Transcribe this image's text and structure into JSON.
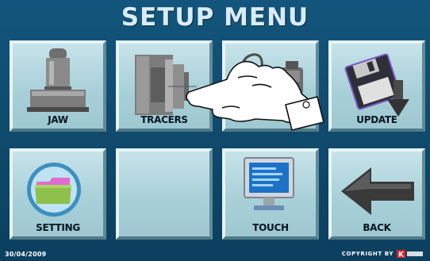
{
  "header": {
    "title": "SETUP MENU"
  },
  "tiles": [
    {
      "label": "JAW",
      "icon": "stamp-icon"
    },
    {
      "label": "TRACERS",
      "icon": "tracer-device-icon"
    },
    {
      "label": "",
      "icon": "calibration-tools-icon"
    },
    {
      "label": "UPDATE",
      "icon": "floppy-download-icon"
    },
    {
      "label": "SETTING",
      "icon": "folder-icon"
    },
    {
      "label": "",
      "icon": ""
    },
    {
      "label": "TOUCH",
      "icon": "monitor-icon"
    },
    {
      "label": "BACK",
      "icon": "back-arrow-icon"
    }
  ],
  "footer": {
    "date": "30/04/2009",
    "copyright": "COPYRIGHT BY",
    "logo_letter": "K"
  },
  "colors": {
    "background": "#13557c",
    "tile": "#a9d0d8",
    "title": "#d9ecf6",
    "logo_red": "#d8232a"
  }
}
